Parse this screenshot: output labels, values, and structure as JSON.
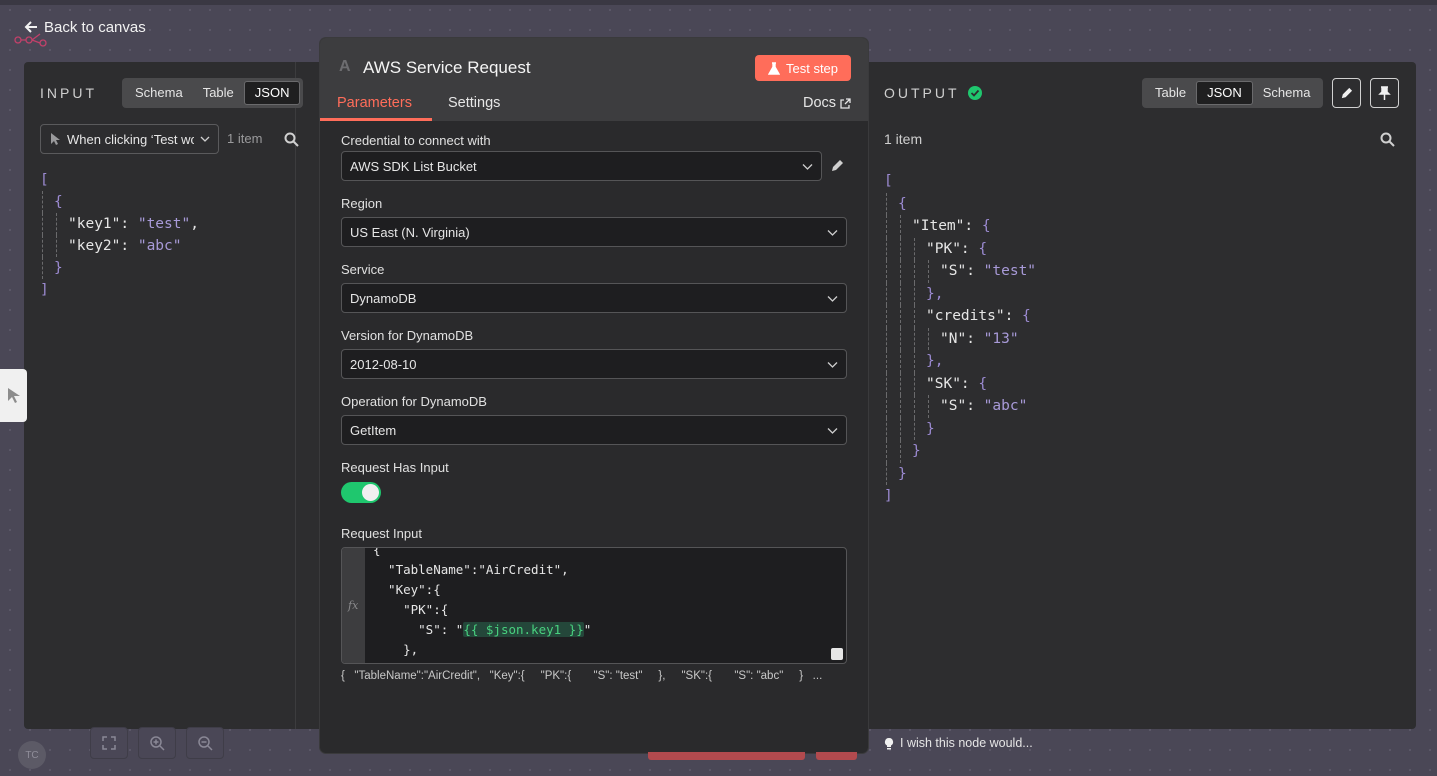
{
  "nav": {
    "back_label": "Back to canvas"
  },
  "input": {
    "title": "INPUT",
    "views": [
      "Schema",
      "Table",
      "JSON"
    ],
    "active_view": "JSON",
    "node_select": "When clicking ‘Test wo",
    "item_count": "1 item",
    "json_lines": [
      {
        "indent": 0,
        "parts": [
          {
            "t": "[",
            "c": "brk"
          }
        ]
      },
      {
        "indent": 1,
        "parts": [
          {
            "t": "{",
            "c": "brk"
          }
        ]
      },
      {
        "indent": 2,
        "parts": [
          {
            "t": "\"key1\": ",
            "c": "key"
          },
          {
            "t": "\"test\"",
            "c": "str"
          },
          {
            "t": ",",
            "c": "key"
          }
        ]
      },
      {
        "indent": 2,
        "parts": [
          {
            "t": "\"key2\": ",
            "c": "key"
          },
          {
            "t": "\"abc\"",
            "c": "str"
          }
        ]
      },
      {
        "indent": 1,
        "parts": [
          {
            "t": "}",
            "c": "brk"
          }
        ]
      },
      {
        "indent": 0,
        "parts": [
          {
            "t": "]",
            "c": "brk"
          }
        ]
      }
    ]
  },
  "node": {
    "icon_letter": "A",
    "title": "AWS Service Request",
    "test_label": "Test step",
    "tabs": [
      "Parameters",
      "Settings"
    ],
    "docs_label": "Docs"
  },
  "params": {
    "credential": {
      "label": "Credential to connect with",
      "value": "AWS SDK List Bucket"
    },
    "region": {
      "label": "Region",
      "value": "US East (N. Virginia)"
    },
    "service": {
      "label": "Service",
      "value": "DynamoDB"
    },
    "version": {
      "label": "Version for DynamoDB",
      "value": "2012-08-10"
    },
    "operation": {
      "label": "Operation for DynamoDB",
      "value": "GetItem"
    },
    "has_input": {
      "label": "Request Has Input",
      "value": true
    },
    "request_input": {
      "label": "Request Input",
      "fx": "fx",
      "code_lines": [
        "{",
        "  \"TableName\":\"AirCredit\",",
        "  \"Key\":{",
        "    \"PK\":{",
        "      \"S\": \"{{ $json.key1 }}\"",
        "    },"
      ],
      "expression": "{{ $json.key1 }}",
      "preview": "{   \"TableName\":\"AirCredit\",   \"Key\":{     \"PK\":{       \"S\": \"test\"     },     \"SK\":{       \"S\": \"abc\"     }   ..."
    }
  },
  "output": {
    "title": "OUTPUT",
    "views": [
      "Table",
      "JSON",
      "Schema"
    ],
    "active_view": "JSON",
    "item_count": "1 item",
    "json_lines": [
      {
        "indent": 0,
        "parts": [
          {
            "t": "[",
            "c": "brk"
          }
        ]
      },
      {
        "indent": 1,
        "parts": [
          {
            "t": "{",
            "c": "brk"
          }
        ]
      },
      {
        "indent": 2,
        "parts": [
          {
            "t": "\"Item\": ",
            "c": "key"
          },
          {
            "t": "{",
            "c": "brk"
          }
        ]
      },
      {
        "indent": 3,
        "parts": [
          {
            "t": "\"PK\": ",
            "c": "key"
          },
          {
            "t": "{",
            "c": "brk"
          }
        ]
      },
      {
        "indent": 4,
        "parts": [
          {
            "t": "\"S\": ",
            "c": "key"
          },
          {
            "t": "\"test\"",
            "c": "str"
          }
        ]
      },
      {
        "indent": 3,
        "parts": [
          {
            "t": "},",
            "c": "brk"
          }
        ]
      },
      {
        "indent": 3,
        "parts": [
          {
            "t": "\"credits\": ",
            "c": "key"
          },
          {
            "t": "{",
            "c": "brk"
          }
        ]
      },
      {
        "indent": 4,
        "parts": [
          {
            "t": "\"N\": ",
            "c": "key"
          },
          {
            "t": "\"13\"",
            "c": "str"
          }
        ]
      },
      {
        "indent": 3,
        "parts": [
          {
            "t": "},",
            "c": "brk"
          }
        ]
      },
      {
        "indent": 3,
        "parts": [
          {
            "t": "\"SK\": ",
            "c": "key"
          },
          {
            "t": "{",
            "c": "brk"
          }
        ]
      },
      {
        "indent": 4,
        "parts": [
          {
            "t": "\"S\": ",
            "c": "key"
          },
          {
            "t": "\"abc\"",
            "c": "str"
          }
        ]
      },
      {
        "indent": 3,
        "parts": [
          {
            "t": "}",
            "c": "brk"
          }
        ]
      },
      {
        "indent": 2,
        "parts": [
          {
            "t": "}",
            "c": "brk"
          }
        ]
      },
      {
        "indent": 1,
        "parts": [
          {
            "t": "}",
            "c": "brk"
          }
        ]
      },
      {
        "indent": 0,
        "parts": [
          {
            "t": "]",
            "c": "brk"
          }
        ]
      }
    ]
  },
  "footer": {
    "wish_label": "I wish this node would...",
    "avatar_initials": "TC"
  },
  "colors": {
    "accent": "#ff6d5a",
    "success": "#1fc76e",
    "json_string": "#a89ad8",
    "expression": "#49d17f"
  }
}
